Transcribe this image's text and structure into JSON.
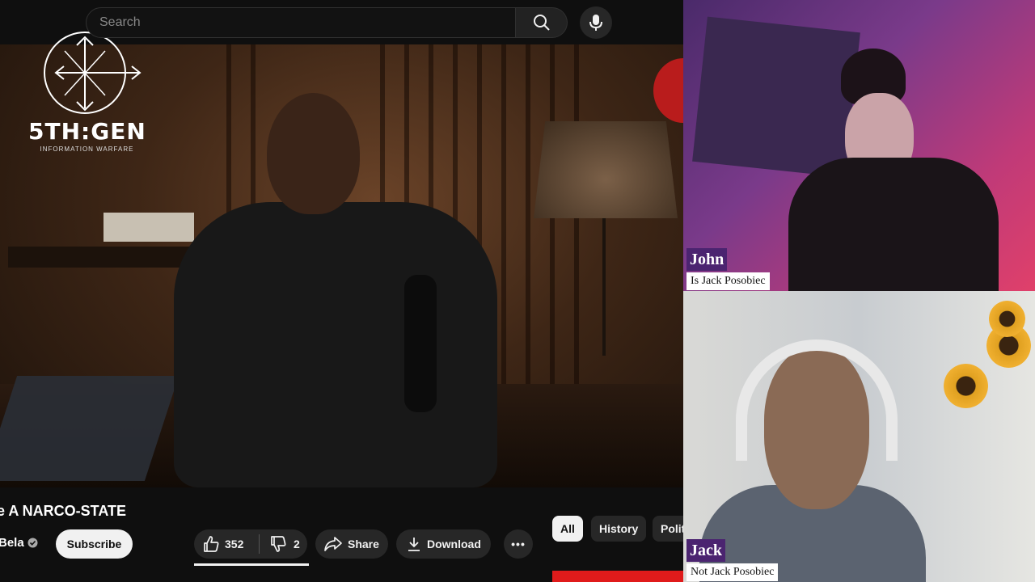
{
  "search": {
    "placeholder": "Search"
  },
  "overlay_logo": {
    "mark": "5TH:GEN",
    "tagline": "INFORMATION WARFARE"
  },
  "video": {
    "title": "e A NARCO-STATE",
    "channel": "Bela",
    "subscribe_label": "Subscribe",
    "likes": "352",
    "dislikes": "2",
    "share_label": "Share",
    "download_label": "Download",
    "more_label": "•••"
  },
  "chips": [
    {
      "label": "All",
      "selected": true
    },
    {
      "label": "History",
      "selected": false
    },
    {
      "label": "Polit",
      "selected": false
    }
  ],
  "cams": [
    {
      "name": "John",
      "caption": "Is Jack Posobiec"
    },
    {
      "name": "Jack",
      "caption": "Not Jack Posobiec"
    }
  ],
  "colors": {
    "name_tag": "#4b2470",
    "accent_red": "#e01b1b",
    "bg": "#0f0f0f"
  },
  "icons": [
    "search-icon",
    "microphone-icon",
    "verified-icon",
    "thumbs-up-icon",
    "thumbs-down-icon",
    "share-icon",
    "download-icon",
    "more-icon"
  ]
}
